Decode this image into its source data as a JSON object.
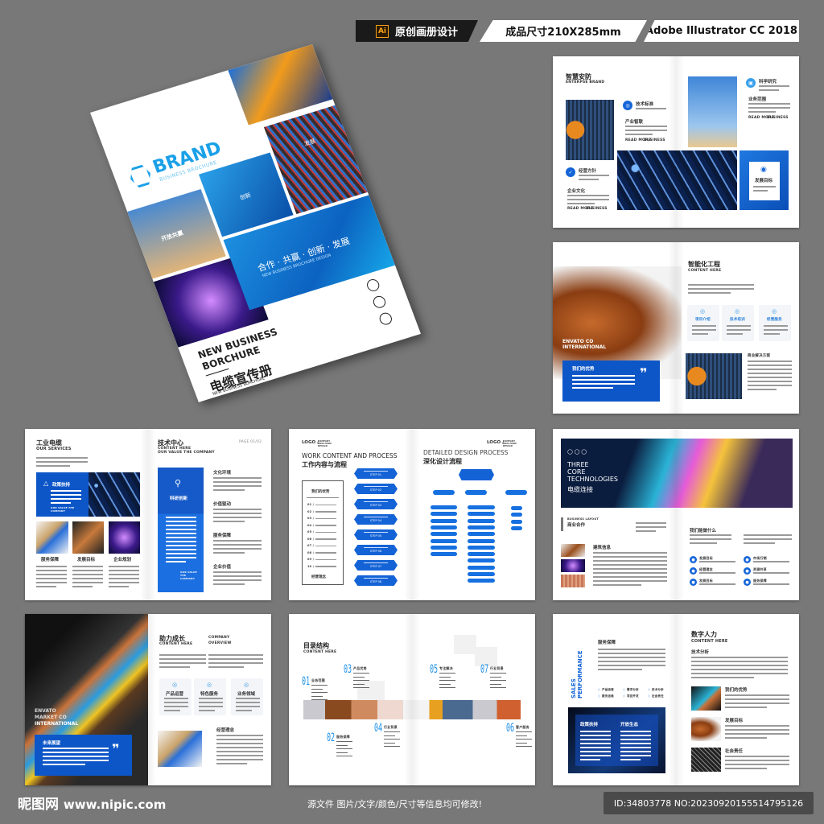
{
  "badges": {
    "ai_icon": "Ai",
    "original": "原创画册设计",
    "size": "成品尺寸210X285mm",
    "software": "Adobe Illustrator CC 2018"
  },
  "cover": {
    "brand": "BRAND",
    "brand_sub": "BUSINESS BROCHURE",
    "tile1": "开放共赢",
    "tile2": "创新",
    "tile3": "发展",
    "slogan": "合作 · 共赢 · 创新 · 发展",
    "slogan_sub": "NEW BUSINESS BROCHURE DESIGN",
    "title_en_1": "NEW BUSINESS",
    "title_en_2": "BORCHURE",
    "title_cn": "电缆宣传册",
    "subtitle": "NEW BUSINESS BORCHURE"
  },
  "spread1": {
    "title": "智慧安防",
    "subtitle": "ENTERPSE BRAND",
    "item1": "技术标准",
    "item2": "产业智联",
    "item3": "经营方针",
    "item4": "企业文化",
    "item5": "科学研究",
    "item6": "业务范围",
    "card": "发展目标",
    "read_more": "READ MORE",
    "business": "BUSINESS"
  },
  "spread2": {
    "title": "智能化工程",
    "subtitle": "CONTENT HERE",
    "overlay": "ENVATO CO INTERNATIONAL",
    "box_title": "我们的优势",
    "quote": "❞",
    "cards": [
      "项目介绍",
      "技术培训",
      "经营服务"
    ],
    "solution": "商业解决方案"
  },
  "spread3": {
    "title": "工业电缆",
    "subtitle": "OUR SERVICES",
    "banner": "政策扶持",
    "banner_sub": "OUR VALUE THE COMPANY",
    "labels": [
      "服务保障",
      "发展目标",
      "企业规划"
    ],
    "r_title": "技术中心",
    "r_sub1": "CONTENT HERE",
    "r_sub2": "OUR VALUE THE COMPANY",
    "page": "PAGE 01/02",
    "column": "科研创新",
    "column_sub": "OUR VALUE THE COMPANY",
    "sections": [
      "文化环境",
      "价值驱动",
      "服务保障",
      "企业价值"
    ]
  },
  "spread4": {
    "logo": "LOGO /",
    "logo_sub": "COMPANY BROCHURE DESIGN",
    "title_en": "WORK CONTENT AND PROCESS",
    "title_cn": "工作内容与流程",
    "box_title": "我们的优势",
    "box_items": [
      "01 /",
      "02 /",
      "03 /",
      "04 /",
      "05 /",
      "06 /",
      "07 /",
      "08 /",
      "09 /",
      "10 /"
    ],
    "box_footer": "经营理念",
    "steps": [
      "STEP 01",
      "STEP 02",
      "STEP 03",
      "STEP 04",
      "STEP 05",
      "STEP 06",
      "STEP 07",
      "STEP 08"
    ],
    "r_title_en": "DETAILED DESIGN PROCESS",
    "r_title_cn": "深化设计流程"
  },
  "spread5": {
    "banner_1": "THREE",
    "banner_2": "CORE",
    "banner_3": "TECHNOLOGIES",
    "banner_cn": "电缆连接",
    "layout": "BUSINESS LAYOUT",
    "layout_cn": "商业合作",
    "info": "建筑信息",
    "what": "我们能做什么",
    "items": [
      "发展目标",
      "市场行销",
      "经营理念",
      "资源共享",
      "发展目标",
      "服务保障"
    ]
  },
  "spread6": {
    "overlay_1": "ENVATO",
    "overlay_2": "MARKET CO",
    "overlay_3": "INTERNATIONAL",
    "box_title": "未来展望",
    "quote": "❞",
    "title": "助力成长",
    "subtitle": "CONTENT HERE",
    "overview_1": "COMPANY",
    "overview_2": "OVERVIEW",
    "cards": [
      "产品运营",
      "特色服务",
      "业务领域"
    ],
    "concept": "经营理念"
  },
  "spread7": {
    "title": "目录结构",
    "subtitle": "CONTENT HERE",
    "entries": [
      {
        "n": "01",
        "label": "业务范围"
      },
      {
        "n": "02",
        "label": "服务保障"
      },
      {
        "n": "03",
        "label": "产品优势"
      },
      {
        "n": "04",
        "label": "行业背景"
      },
      {
        "n": "05",
        "label": "专注解决"
      },
      {
        "n": "06",
        "label": "客户服务"
      },
      {
        "n": "07",
        "label": "行业背景"
      }
    ]
  },
  "spread8": {
    "vertical_1": "SALES",
    "vertical_2": "PERFORMANCE",
    "title": "服务保障",
    "bullets": [
      "产品运营",
      "需求分析",
      "技术分析",
      "服务运维",
      "项目开发",
      "社会责任"
    ],
    "box_1": "政策扶持",
    "box_2": "开放生态",
    "r_title": "数字人力",
    "r_sub": "CONTENT HERE",
    "r_section": "技术分析",
    "items": [
      "我们的优势",
      "发展目标",
      "社会责任"
    ]
  },
  "footer": {
    "logo_cn": "昵图网",
    "logo_url": "www.nipic.com",
    "notice": "源文件 图片/文字/颜色/尺寸等信息均可修改!",
    "id": "ID:34803778 NO:20230920155514795126"
  },
  "colors": {
    "accent": "#0d56c8",
    "background": "#787878",
    "cyan": "#1a8ee6"
  }
}
